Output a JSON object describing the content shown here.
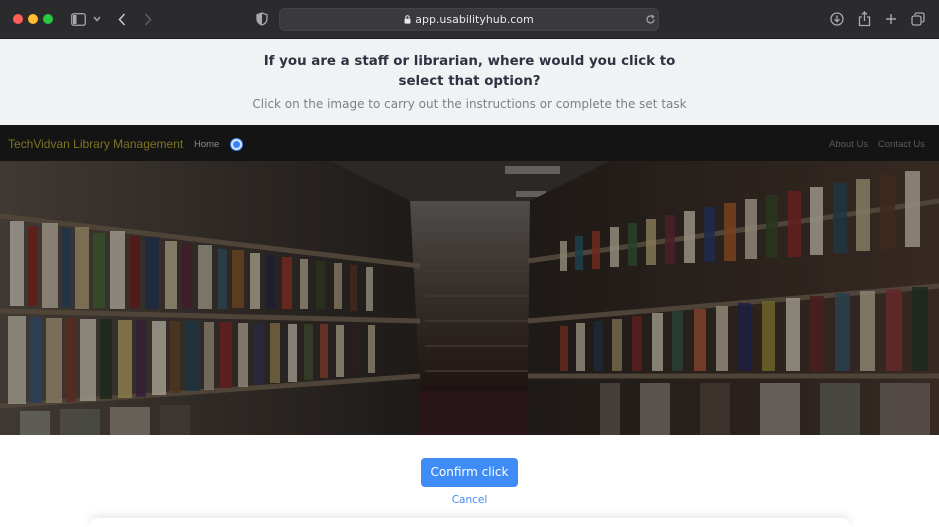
{
  "browser": {
    "url": "app.usabilityhub.com"
  },
  "task": {
    "question": "If you are a staff or librarian, where would you click to select that option?",
    "instruction": "Click on the image to carry out the instructions or complete the set task"
  },
  "site": {
    "brand": "TechVidvan Library Management",
    "nav": {
      "home": "Home",
      "about": "About Us",
      "contact": "Contact Us"
    }
  },
  "actions": {
    "confirm_label": "Confirm click",
    "cancel_label": "Cancel"
  },
  "colors": {
    "accent": "#3f8cf7",
    "chrome": "#2b2b2d",
    "header_bg": "#f1f2f4"
  },
  "icons": [
    "sidebar-icon",
    "chevron-down-icon",
    "back-icon",
    "forward-icon",
    "privacy-shield-icon",
    "lock-icon",
    "reload-icon",
    "download-icon",
    "share-icon",
    "new-tab-icon",
    "tabs-overview-icon"
  ]
}
